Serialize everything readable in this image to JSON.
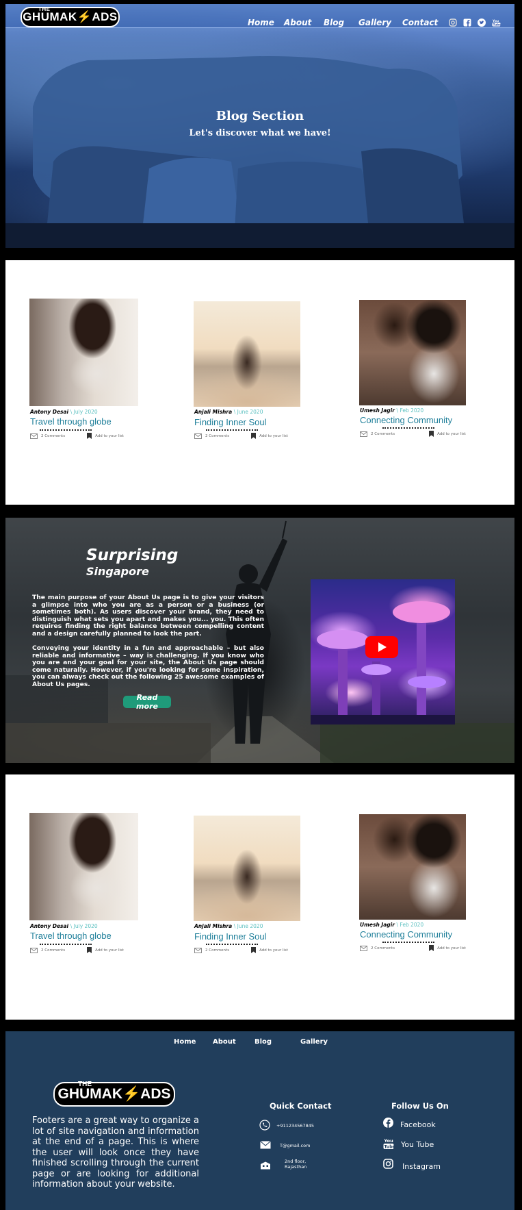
{
  "header": {
    "logo_the": "THE",
    "logo_name_a": "GHUMAK",
    "logo_name_b": "ADS",
    "nav": [
      "Home",
      "About",
      "Blog",
      "Gallery",
      "Contact"
    ],
    "social_icons": [
      "instagram-icon",
      "facebook-icon",
      "twitter-icon",
      "youtube-icon"
    ]
  },
  "hero": {
    "title": "Blog Section",
    "subtitle": "Let's discover what we have!"
  },
  "cards": [
    {
      "author": "Antony Desai",
      "date": "\\ July 2020",
      "title": "Travel through globe",
      "comments": "2 Comments",
      "list": "Add to your list"
    },
    {
      "author": "Anjali Mishra",
      "date": "\\ June 2020",
      "title": "Finding Inner Soul",
      "comments": "2 Comments",
      "list": "Add to your list"
    },
    {
      "author": "Umesh Jagir",
      "date": "\\ Feb 2020",
      "title": "Connecting Community",
      "comments": "2 Comments",
      "list": "Add to your list"
    }
  ],
  "feature": {
    "title": "Surprising",
    "subtitle": "Singapore",
    "paragraph_1": "The main purpose of your About Us page is to give your visitors a glimpse into who you are as a person or a business (or sometimes both). As users discover your brand, they need to distinguish what sets you apart and makes you... you. This often requires finding the right balance between compelling content and a design carefully planned to look the part.",
    "paragraph_2": "Conveying your identity in a fun and approachable – but also reliable and informative – way is challenging. If you know who you are and your goal for your site, the About Us page should come naturally. However, if you're looking for some inspiration, you can always check out the following 25 awesome examples of About Us pages.",
    "button": "Read more"
  },
  "footer": {
    "nav": [
      "Home",
      "About",
      "Blog",
      "Gallery"
    ],
    "logo_the": "THE",
    "logo_name_a": "GHUMAK",
    "logo_name_b": "ADS",
    "description": "Footers are a great way to organize a lot of site navigation and information at the end of a page. This is where the user will look once they have finished scrolling through the current page or are looking for additional information about your website.",
    "contact_heading": "Quick Contact",
    "phone": "+911234567845",
    "email": "T@gmail.com",
    "address_1": "2nd floor,",
    "address_2": "Rajasthan",
    "follow_heading": "Follow Us On",
    "facebook": "Facebook",
    "youtube": "You Tube",
    "instagram": "Instagram"
  },
  "colors": {
    "card_title": "#1f7f9a",
    "card_date": "#5bc0c0",
    "button": "#1f9b7a",
    "footer_bg": "#213e5c",
    "youtube_red": "#ff0000"
  }
}
